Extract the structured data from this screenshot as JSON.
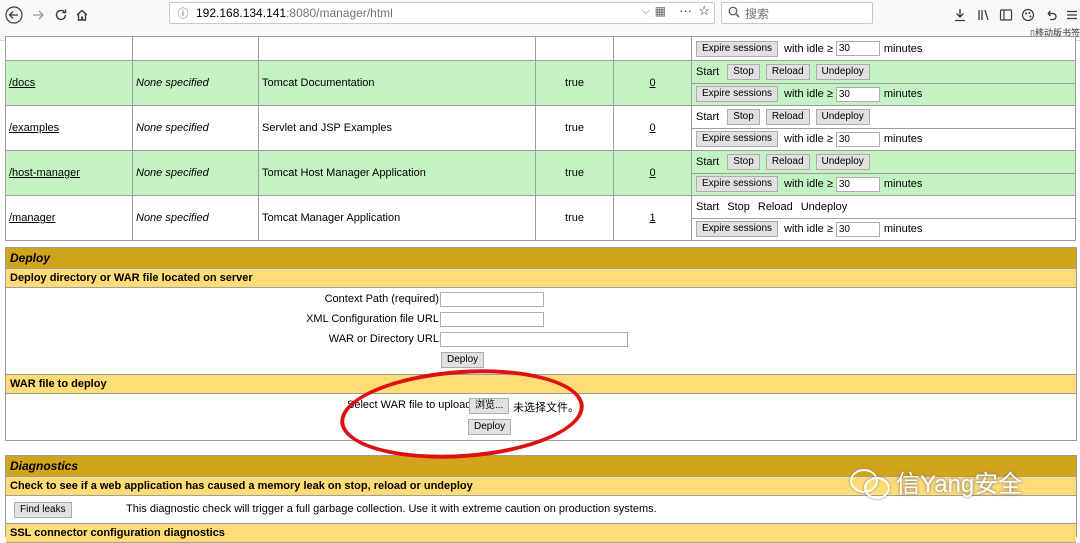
{
  "browser": {
    "url_host": "192.168.134.141",
    "url_path": ":8080/manager/html",
    "search_placeholder": "搜索",
    "mobile_bookmarks": "移动版书签"
  },
  "applications": {
    "rows": [
      {
        "path": "",
        "version": "",
        "display_name": "",
        "running": "",
        "sessions": "",
        "partial": true
      },
      {
        "path": "/docs",
        "version": "None specified",
        "display_name": "Tomcat Documentation",
        "running": "true",
        "sessions": "0"
      },
      {
        "path": "/examples",
        "version": "None specified",
        "display_name": "Servlet and JSP Examples",
        "running": "true",
        "sessions": "0"
      },
      {
        "path": "/host-manager",
        "version": "None specified",
        "display_name": "Tomcat Host Manager Application",
        "running": "true",
        "sessions": "0"
      },
      {
        "path": "/manager",
        "version": "None specified",
        "display_name": "Tomcat Manager Application",
        "running": "true",
        "sessions": "1"
      }
    ],
    "commands": {
      "start": "Start",
      "stop": "Stop",
      "reload": "Reload",
      "undeploy": "Undeploy",
      "expire": "Expire sessions",
      "with_idle": "with idle ≥",
      "idle_value": "30",
      "minutes": "minutes"
    }
  },
  "deploy": {
    "title": "Deploy",
    "server_subtitle": "Deploy directory or WAR file located on server",
    "context_path_label": "Context Path (required):",
    "xml_config_label": "XML Configuration file URL:",
    "war_dir_label": "WAR or Directory URL:",
    "deploy_button": "Deploy",
    "war_subtitle": "WAR file to deploy",
    "select_war_label": "Select WAR file to upload",
    "browse_button": "浏览...",
    "no_file": "未选择文件。",
    "deploy_button2": "Deploy"
  },
  "diagnostics": {
    "title": "Diagnostics",
    "leak_subtitle": "Check to see if a web application has caused a memory leak on stop, reload or undeploy",
    "find_leaks_button": "Find leaks",
    "leak_note": "This diagnostic check will trigger a full garbage collection. Use it with extreme caution on production systems.",
    "ssl_subtitle": "SSL connector configuration diagnostics"
  },
  "watermark": {
    "text": "信Yang安全"
  },
  "colors": {
    "green_row": "#c3f3c3",
    "section_title": "#d2a41c",
    "section_sub": "#ffdc75",
    "annotation": "#e01010"
  }
}
